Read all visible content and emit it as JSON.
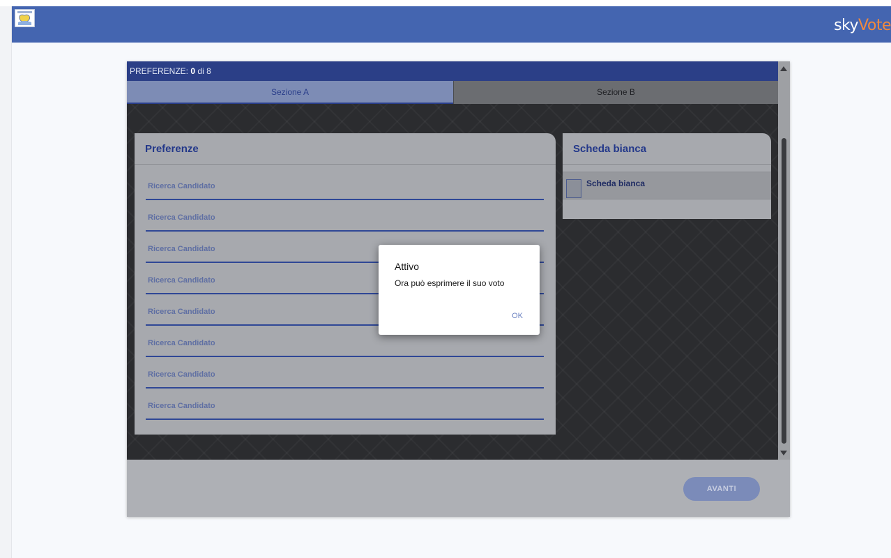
{
  "header": {
    "logo_icon": "region-emblem-icon",
    "brand_sky": "sky",
    "brand_vote": "Vote",
    "bar_color": "#4465b0",
    "accent_color": "#f0893e"
  },
  "ballot": {
    "preferences_label": "PREFERENZE:",
    "preferences_count": "0",
    "preferences_of": "di 8",
    "tabs": [
      {
        "label": "Sezione A"
      },
      {
        "label": "Sezione B"
      }
    ],
    "preferences_card": {
      "title": "Preferenze",
      "rows": [
        {
          "label": "Ricerca Candidato"
        },
        {
          "label": "Ricerca Candidato"
        },
        {
          "label": "Ricerca Candidato"
        },
        {
          "label": "Ricerca Candidato"
        },
        {
          "label": "Ricerca Candidato"
        },
        {
          "label": "Ricerca Candidato"
        },
        {
          "label": "Ricerca Candidato"
        },
        {
          "label": "Ricerca Candidato"
        }
      ]
    },
    "blank_card": {
      "title": "Scheda bianca",
      "option_label": "Scheda bianca"
    },
    "next_button": "AVANTI"
  },
  "dialog": {
    "title": "Attivo",
    "message": "Ora può esprimere il suo voto",
    "ok_label": "OK"
  }
}
